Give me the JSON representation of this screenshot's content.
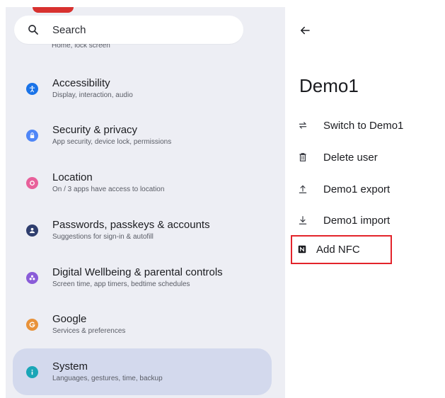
{
  "settings": {
    "search_placeholder": "Search",
    "peek_text": "Home, lock screen",
    "items": [
      {
        "title": "Accessibility",
        "subtitle": "Display, interaction, audio",
        "color": "#1a73e8",
        "icon": "accessibility-icon"
      },
      {
        "title": "Security & privacy",
        "subtitle": "App security, device lock, permissions",
        "color": "#4f86f7",
        "icon": "lock-icon"
      },
      {
        "title": "Location",
        "subtitle": "On / 3 apps have access to location",
        "color": "#e8609a",
        "icon": "location-icon"
      },
      {
        "title": "Passwords, passkeys & accounts",
        "subtitle": "Suggestions for sign-in & autofill",
        "color": "#2f3e6e",
        "icon": "accounts-icon"
      },
      {
        "title": "Digital Wellbeing & parental controls",
        "subtitle": "Screen time, app timers, bedtime schedules",
        "color": "#8a5cd8",
        "icon": "wellbeing-icon"
      },
      {
        "title": "Google",
        "subtitle": "Services & preferences",
        "color": "#e8923a",
        "icon": "google-icon"
      },
      {
        "title": "System",
        "subtitle": "Languages, gestures, time, backup",
        "color": "#1aa6b7",
        "icon": "info-icon"
      }
    ]
  },
  "detail": {
    "user_name": "Demo1",
    "actions": [
      {
        "label": "Switch to Demo1",
        "icon": "switch-icon"
      },
      {
        "label": "Delete user",
        "icon": "trash-icon"
      },
      {
        "label": "Demo1 export",
        "icon": "upload-icon"
      },
      {
        "label": "Demo1 import",
        "icon": "download-icon"
      }
    ],
    "nfc_label": "Add NFC"
  },
  "colors": {
    "left_bg": "#edeef4",
    "selected_bg": "#d3d9ed",
    "highlight": "#e3242b"
  }
}
